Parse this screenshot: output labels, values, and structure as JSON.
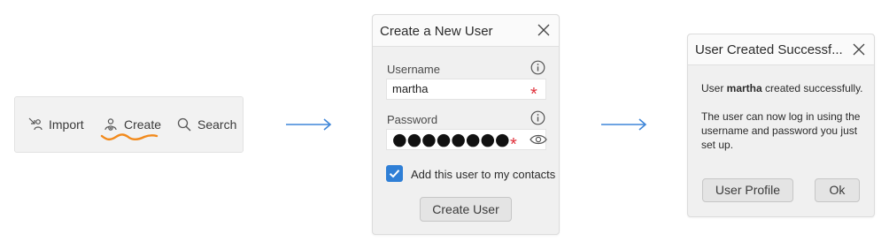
{
  "toolbar": {
    "items": [
      {
        "label": "Import",
        "icon": "import-icon"
      },
      {
        "label": "Create",
        "icon": "create-user-icon"
      },
      {
        "label": "Search",
        "icon": "search-icon"
      }
    ],
    "highlight_color": "#f28a1c"
  },
  "create_dialog": {
    "title": "Create a New User",
    "username_label": "Username",
    "username_value": "martha",
    "password_label": "Password",
    "password_value": "●●●●●●●●",
    "required_mark": "*",
    "checkbox_checked": true,
    "checkbox_label": "Add this user to my contacts",
    "submit_label": "Create User"
  },
  "success_dialog": {
    "title": "User Created Successf...",
    "msg_prefix": "User ",
    "msg_user": "martha",
    "msg_suffix": " created successfully.",
    "msg_body": "The user can now log in using the username and password you just set up.",
    "profile_label": "User Profile",
    "ok_label": "Ok"
  },
  "colors": {
    "accent": "#2f7fd6",
    "arrow": "#3f86d8",
    "required": "#e0303a"
  }
}
